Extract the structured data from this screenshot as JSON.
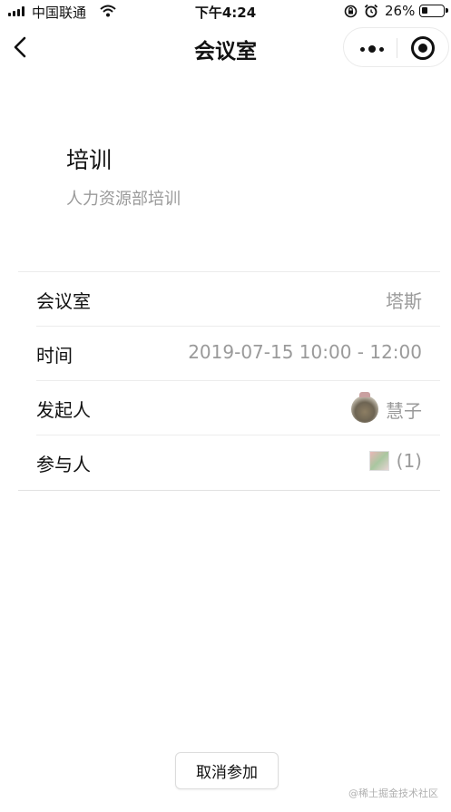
{
  "status_bar": {
    "carrier": "中国联通",
    "time": "下午4:24",
    "battery_percent": "26%",
    "battery_level": 0.26
  },
  "nav": {
    "title": "会议室"
  },
  "meeting": {
    "title": "培训",
    "subtitle": "人力资源部培训"
  },
  "details": [
    {
      "label": "会议室",
      "value": "塔斯"
    },
    {
      "label": "时间",
      "value": "2019-07-15 10:00 - 12:00"
    },
    {
      "label": "发起人",
      "value": "慧子"
    },
    {
      "label": "参与人",
      "value": "(1)"
    }
  ],
  "actions": {
    "cancel_label": "取消参加"
  },
  "watermark": "@稀土掘金技术社区",
  "icons": {
    "back": "chevron-left-icon",
    "more": "more-dots-icon",
    "close_miniprogram": "target-circle-icon",
    "wifi": "wifi-icon",
    "rotation_lock": "rotation-lock-icon",
    "alarm": "alarm-icon",
    "battery": "battery-icon"
  }
}
